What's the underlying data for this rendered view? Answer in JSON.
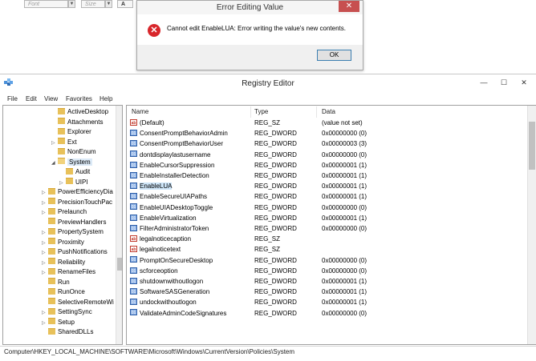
{
  "background_app": {
    "font_placeholder": "Font",
    "size_placeholder": "Size",
    "font_color_glyph": "A"
  },
  "dialog": {
    "title": "Error Editing Value",
    "close_glyph": "✕",
    "message": "Cannot edit EnableLUA:  Error writing the value's new contents.",
    "ok_label": "OK"
  },
  "window": {
    "title": "Registry Editor",
    "minimize": "—",
    "maximize": "☐",
    "close": "✕"
  },
  "menu": [
    "File",
    "Edit",
    "View",
    "Favorites",
    "Help"
  ],
  "tree": [
    {
      "label": "ActiveDesktop",
      "indent": 2
    },
    {
      "label": "Attachments",
      "indent": 2
    },
    {
      "label": "Explorer",
      "indent": 2
    },
    {
      "label": "Ext",
      "indent": 2,
      "expander": "▷"
    },
    {
      "label": "NonEnum",
      "indent": 2
    },
    {
      "label": "System",
      "indent": 2,
      "expander": "◢",
      "open": true,
      "selected": true
    },
    {
      "label": "Audit",
      "indent": 3
    },
    {
      "label": "UIPI",
      "indent": 3,
      "expander": "▷"
    },
    {
      "label": "PowerEfficiencyDia",
      "indent": 1,
      "expander": "▷"
    },
    {
      "label": "PrecisionTouchPac",
      "indent": 1,
      "expander": "▷"
    },
    {
      "label": "Prelaunch",
      "indent": 1,
      "expander": "▷"
    },
    {
      "label": "PreviewHandlers",
      "indent": 1
    },
    {
      "label": "PropertySystem",
      "indent": 1,
      "expander": "▷"
    },
    {
      "label": "Proximity",
      "indent": 1,
      "expander": "▷"
    },
    {
      "label": "PushNotifications",
      "indent": 1,
      "expander": "▷"
    },
    {
      "label": "Reliability",
      "indent": 1,
      "expander": "▷"
    },
    {
      "label": "RenameFiles",
      "indent": 1,
      "expander": "▷"
    },
    {
      "label": "Run",
      "indent": 1
    },
    {
      "label": "RunOnce",
      "indent": 1
    },
    {
      "label": "SelectiveRemoteWi",
      "indent": 1
    },
    {
      "label": "SettingSync",
      "indent": 1,
      "expander": "▷"
    },
    {
      "label": "Setup",
      "indent": 1,
      "expander": "▷"
    },
    {
      "label": "SharedDLLs",
      "indent": 1
    }
  ],
  "columns": {
    "name": "Name",
    "type": "Type",
    "data": "Data"
  },
  "values": [
    {
      "name": "(Default)",
      "type": "REG_SZ",
      "data": "(value not set)",
      "kind": "sz"
    },
    {
      "name": "ConsentPromptBehaviorAdmin",
      "type": "REG_DWORD",
      "data": "0x00000000 (0)",
      "kind": "dw"
    },
    {
      "name": "ConsentPromptBehaviorUser",
      "type": "REG_DWORD",
      "data": "0x00000003 (3)",
      "kind": "dw"
    },
    {
      "name": "dontdisplaylastusername",
      "type": "REG_DWORD",
      "data": "0x00000000 (0)",
      "kind": "dw"
    },
    {
      "name": "EnableCursorSuppression",
      "type": "REG_DWORD",
      "data": "0x00000001 (1)",
      "kind": "dw"
    },
    {
      "name": "EnableInstallerDetection",
      "type": "REG_DWORD",
      "data": "0x00000001 (1)",
      "kind": "dw"
    },
    {
      "name": "EnableLUA",
      "type": "REG_DWORD",
      "data": "0x00000001 (1)",
      "kind": "dw",
      "selected": true
    },
    {
      "name": "EnableSecureUIAPaths",
      "type": "REG_DWORD",
      "data": "0x00000001 (1)",
      "kind": "dw"
    },
    {
      "name": "EnableUIADesktopToggle",
      "type": "REG_DWORD",
      "data": "0x00000000 (0)",
      "kind": "dw"
    },
    {
      "name": "EnableVirtualization",
      "type": "REG_DWORD",
      "data": "0x00000001 (1)",
      "kind": "dw"
    },
    {
      "name": "FilterAdministratorToken",
      "type": "REG_DWORD",
      "data": "0x00000000 (0)",
      "kind": "dw"
    },
    {
      "name": "legalnoticecaption",
      "type": "REG_SZ",
      "data": "",
      "kind": "sz"
    },
    {
      "name": "legalnoticetext",
      "type": "REG_SZ",
      "data": "",
      "kind": "sz"
    },
    {
      "name": "PromptOnSecureDesktop",
      "type": "REG_DWORD",
      "data": "0x00000000 (0)",
      "kind": "dw"
    },
    {
      "name": "scforceoption",
      "type": "REG_DWORD",
      "data": "0x00000000 (0)",
      "kind": "dw"
    },
    {
      "name": "shutdownwithoutlogon",
      "type": "REG_DWORD",
      "data": "0x00000001 (1)",
      "kind": "dw"
    },
    {
      "name": "SoftwareSASGeneration",
      "type": "REG_DWORD",
      "data": "0x00000001 (1)",
      "kind": "dw"
    },
    {
      "name": "undockwithoutlogon",
      "type": "REG_DWORD",
      "data": "0x00000001 (1)",
      "kind": "dw"
    },
    {
      "name": "ValidateAdminCodeSignatures",
      "type": "REG_DWORD",
      "data": "0x00000000 (0)",
      "kind": "dw"
    }
  ],
  "status_path": "Computer\\HKEY_LOCAL_MACHINE\\SOFTWARE\\Microsoft\\Windows\\CurrentVersion\\Policies\\System",
  "icons": {
    "string_value": "ab-string-icon",
    "dword_value": "binary-value-icon",
    "folder": "folder-icon"
  }
}
